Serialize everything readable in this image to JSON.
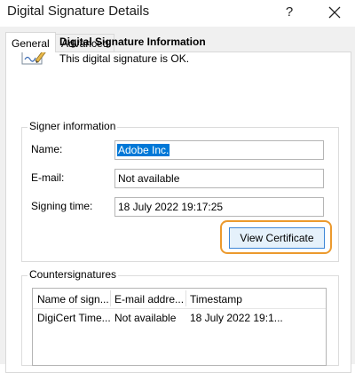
{
  "window": {
    "title": "Digital Signature Details",
    "help_label": "?",
    "close_icon": "close-icon"
  },
  "tabs": [
    {
      "label": "General",
      "active": true
    },
    {
      "label": "Advanced",
      "active": false
    }
  ],
  "info": {
    "icon": "signature-document-icon",
    "title": "Digital Signature Information",
    "status": "This digital signature is OK."
  },
  "signer": {
    "group_label": "Signer information",
    "name_label": "Name:",
    "name_value": "Adobe Inc.",
    "email_label": "E-mail:",
    "email_value": "Not available",
    "time_label": "Signing time:",
    "time_value": "18 July 2022 19:17:25",
    "view_cert_label": "View Certificate",
    "highlight_color": "#ec9a2e"
  },
  "countersignatures": {
    "group_label": "Countersignatures",
    "columns": [
      "Name of sign...",
      "E-mail addre...",
      "Timestamp"
    ],
    "rows": [
      [
        "DigiCert Time...",
        "Not available",
        "18 July 2022 19:1..."
      ]
    ]
  }
}
